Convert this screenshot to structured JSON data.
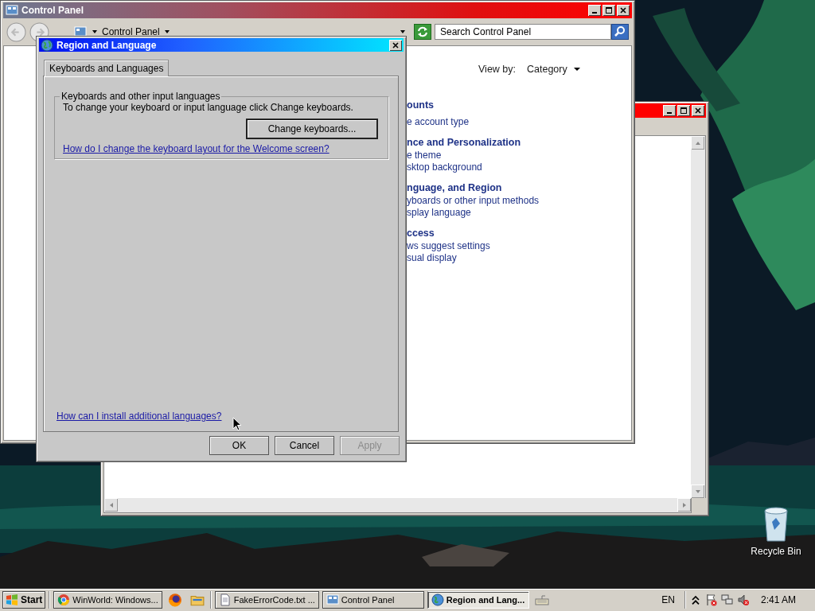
{
  "control_panel": {
    "title": "Control Panel",
    "breadcrumb": "Control Panel",
    "search": {
      "placeholder": "Search Control Panel"
    },
    "view_by": {
      "label": "View by:",
      "value": "Category"
    },
    "categories": [
      {
        "heading": "ounts",
        "links": [
          "e account type"
        ]
      },
      {
        "heading": "nce and Personalization",
        "links": [
          "e theme",
          "sktop background"
        ]
      },
      {
        "heading": "nguage, and Region",
        "links": [
          "yboards or other input methods",
          "splay language"
        ]
      },
      {
        "heading": "ccess",
        "links": [
          "ws suggest settings",
          "sual display"
        ]
      }
    ]
  },
  "dialog": {
    "title": "Region and Language",
    "tabs": [
      {
        "label": "Keyboards and Languages",
        "selected": true
      }
    ],
    "group": {
      "title": "Keyboards and other input languages",
      "text": "To change your keyboard or input language click Change keyboards.",
      "button": "Change keyboards...",
      "link": "How do I change the keyboard layout for the Welcome screen?"
    },
    "bottom_link": "How can I install additional languages?",
    "buttons": [
      {
        "label": "OK",
        "disabled": false
      },
      {
        "label": "Cancel",
        "disabled": false
      },
      {
        "label": "Apply",
        "disabled": true
      }
    ]
  },
  "desktop_icons": [
    {
      "label": "Recycle Bin"
    }
  ],
  "taskbar": {
    "start": "Start",
    "tasks": [
      {
        "label": "WinWorld: Windows...",
        "selected": false
      },
      {
        "label": "FakeErrorCode.txt ...",
        "selected": false
      },
      {
        "label": "Control Panel",
        "selected": false
      },
      {
        "label": "Region and Lang...",
        "selected": true
      }
    ],
    "language": "EN",
    "clock": "2:41 AM"
  }
}
